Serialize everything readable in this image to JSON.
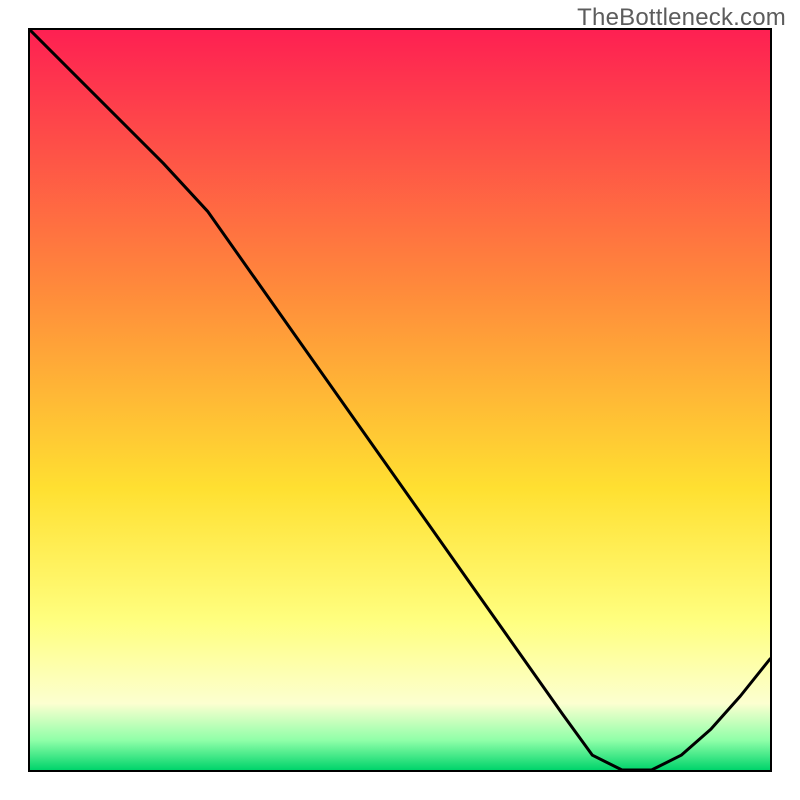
{
  "watermark": "TheBottleneck.com",
  "gradient": {
    "top": "#fe2052",
    "mid1": "#ff8a3b",
    "mid2": "#ffe031",
    "mid3": "#ffff80",
    "mid4": "#fcffd0",
    "dip": "#8fffa8",
    "bottom": "#00d46b"
  },
  "marker_label": "",
  "chart_data": {
    "type": "line",
    "title": "",
    "xlabel": "",
    "ylabel": "",
    "xlim": [
      0,
      1
    ],
    "ylim": [
      0,
      1
    ],
    "x": [
      0.0,
      0.06,
      0.12,
      0.18,
      0.24,
      0.3,
      0.36,
      0.42,
      0.48,
      0.54,
      0.6,
      0.66,
      0.72,
      0.76,
      0.8,
      0.84,
      0.88,
      0.92,
      0.96,
      1.0
    ],
    "y": [
      1.0,
      0.94,
      0.88,
      0.82,
      0.755,
      0.67,
      0.585,
      0.5,
      0.415,
      0.33,
      0.245,
      0.16,
      0.075,
      0.02,
      0.0,
      0.0,
      0.02,
      0.055,
      0.1,
      0.15
    ],
    "annotations": [
      {
        "text": "",
        "x": 0.82,
        "y": 0.015
      }
    ]
  }
}
